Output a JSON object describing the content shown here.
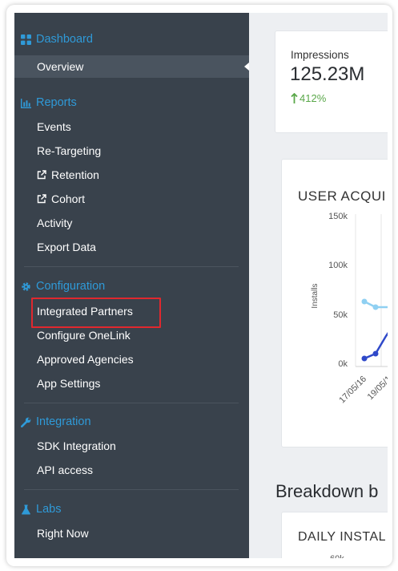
{
  "sidebar": {
    "sections": [
      {
        "title": "Dashboard",
        "icon": "dashboard-grid-icon",
        "items": [
          {
            "label": "Overview",
            "active": true
          }
        ]
      },
      {
        "title": "Reports",
        "icon": "bar-chart-icon",
        "items": [
          {
            "label": "Events"
          },
          {
            "label": "Re-Targeting"
          },
          {
            "label": "Retention",
            "icon": "external-link-icon"
          },
          {
            "label": "Cohort",
            "icon": "external-link-icon"
          },
          {
            "label": "Activity"
          },
          {
            "label": "Export Data"
          }
        ]
      },
      {
        "title": "Configuration",
        "icon": "gear-icon",
        "items": [
          {
            "label": "Integrated Partners",
            "highlighted": true
          },
          {
            "label": "Configure OneLink"
          },
          {
            "label": "Approved Agencies"
          },
          {
            "label": "App Settings"
          }
        ]
      },
      {
        "title": "Integration",
        "icon": "wrench-icon",
        "items": [
          {
            "label": "SDK Integration"
          },
          {
            "label": "API access"
          }
        ]
      },
      {
        "title": "Labs",
        "icon": "flask-icon",
        "items": [
          {
            "label": "Right Now"
          }
        ]
      }
    ]
  },
  "kpi": {
    "label": "Impressions",
    "value": "125.23M",
    "delta": "412%"
  },
  "user_acquisition": {
    "title": "USER ACQUI",
    "ylabel": "Installs",
    "yticks": [
      "150k",
      "100k",
      "50k",
      "0k"
    ],
    "xticks": [
      "17/05/16",
      "19/05/1"
    ]
  },
  "breakdown": {
    "title": "Breakdown b"
  },
  "daily": {
    "title": "DAILY INSTAL",
    "tick": "60k"
  },
  "colors": {
    "sidebar_bg": "#39424c",
    "accent": "#2f9ad8",
    "highlight": "#e0282e",
    "positive": "#5aa84a"
  }
}
